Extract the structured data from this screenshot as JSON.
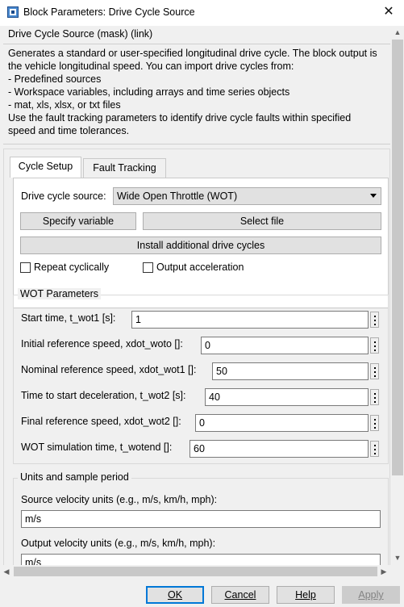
{
  "window": {
    "title": "Block Parameters: Drive Cycle Source",
    "close_glyph": "✕"
  },
  "mask": {
    "title": "Drive Cycle Source (mask) (link)",
    "description": "Generates a standard or user-specified longitudinal drive cycle. The block output is\nthe vehicle longitudinal speed. You can import drive cycles from:\n- Predefined sources\n- Workspace variables, including arrays and time series objects\n- mat, xls, xlsx, or txt files\nUse the fault tracking parameters to identify drive cycle faults within specified\nspeed and time tolerances."
  },
  "tabs": [
    {
      "label": "Cycle Setup",
      "active": true
    },
    {
      "label": "Fault Tracking",
      "active": false
    }
  ],
  "cycle_setup": {
    "source_label": "Drive cycle source:",
    "source_value": "Wide Open Throttle (WOT)",
    "specify_variable": "Specify variable",
    "select_file": "Select file",
    "install_cycles": "Install additional drive cycles",
    "repeat_label": "Repeat cyclically",
    "repeat_checked": false,
    "accel_label": "Output acceleration",
    "accel_checked": false
  },
  "wot": {
    "legend": "WOT Parameters",
    "params": [
      {
        "label": "Start time, t_wot1 [s]:",
        "value": "1"
      },
      {
        "label": "Initial reference speed, xdot_woto []:",
        "value": "0"
      },
      {
        "label": "Nominal reference speed, xdot_wot1 []:",
        "value": "50"
      },
      {
        "label": "Time to start deceleration, t_wot2 [s]:",
        "value": "40"
      },
      {
        "label": "Final reference speed, xdot_wot2 []:",
        "value": "0"
      },
      {
        "label": "WOT simulation time, t_wotend []:",
        "value": "60"
      }
    ]
  },
  "units": {
    "legend": "Units and sample period",
    "source_label": "Source velocity units (e.g., m/s, km/h, mph):",
    "source_value": "m/s",
    "output_label": "Output velocity units (e.g., m/s, km/h, mph):",
    "output_value": "m/s"
  },
  "buttons": {
    "ok": "OK",
    "cancel": "Cancel",
    "help": "Help",
    "apply": "Apply"
  },
  "icons": {
    "app": "simulink-block-icon",
    "close": "close-icon",
    "more": "ellipsis-icon",
    "dropdown": "chevron-down-icon"
  }
}
